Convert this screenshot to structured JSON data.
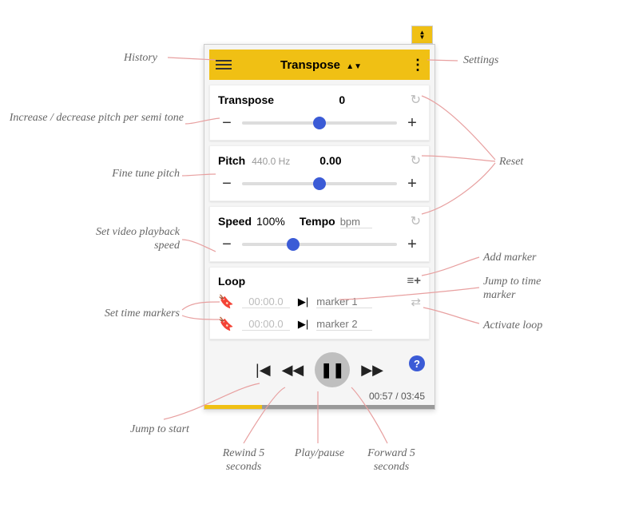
{
  "header": {
    "title": "Transpose",
    "arrows": "▲▼"
  },
  "transpose_panel": {
    "label": "Transpose",
    "value": "0",
    "minus": "−",
    "plus": "+",
    "thumb_percent": 50
  },
  "pitch_panel": {
    "label": "Pitch",
    "sub": "440.0 Hz",
    "value": "0.00",
    "minus": "−",
    "plus": "+",
    "thumb_percent": 50
  },
  "speed_panel": {
    "label": "Speed",
    "value": "100%",
    "tempo_label": "Tempo",
    "bpm_placeholder": "bpm",
    "minus": "−",
    "plus": "+",
    "thumb_percent": 33
  },
  "loop_panel": {
    "label": "Loop",
    "add_icon": "≡+",
    "markers": [
      {
        "time": "00:00.0",
        "name_placeholder": "marker 1"
      },
      {
        "time": "00:00.0",
        "name_placeholder": "marker 2"
      }
    ]
  },
  "playback": {
    "timecode": "00:57 / 03:45",
    "progress_percent": 25,
    "help": "?"
  },
  "annotations": {
    "history": "History",
    "settings": "Settings",
    "pitch_semi": "Increase / decrease pitch per semi tone",
    "fine_tune": "Fine tune pitch",
    "playback_speed": "Set video playback speed",
    "set_markers": "Set time markers",
    "reset": "Reset",
    "add_marker": "Add marker",
    "jump_marker": "Jump to time marker",
    "activate_loop": "Activate loop",
    "jump_start": "Jump to start",
    "rewind": "Rewind 5 seconds",
    "playpause": "Play/pause",
    "forward": "Forward 5 seconds"
  }
}
